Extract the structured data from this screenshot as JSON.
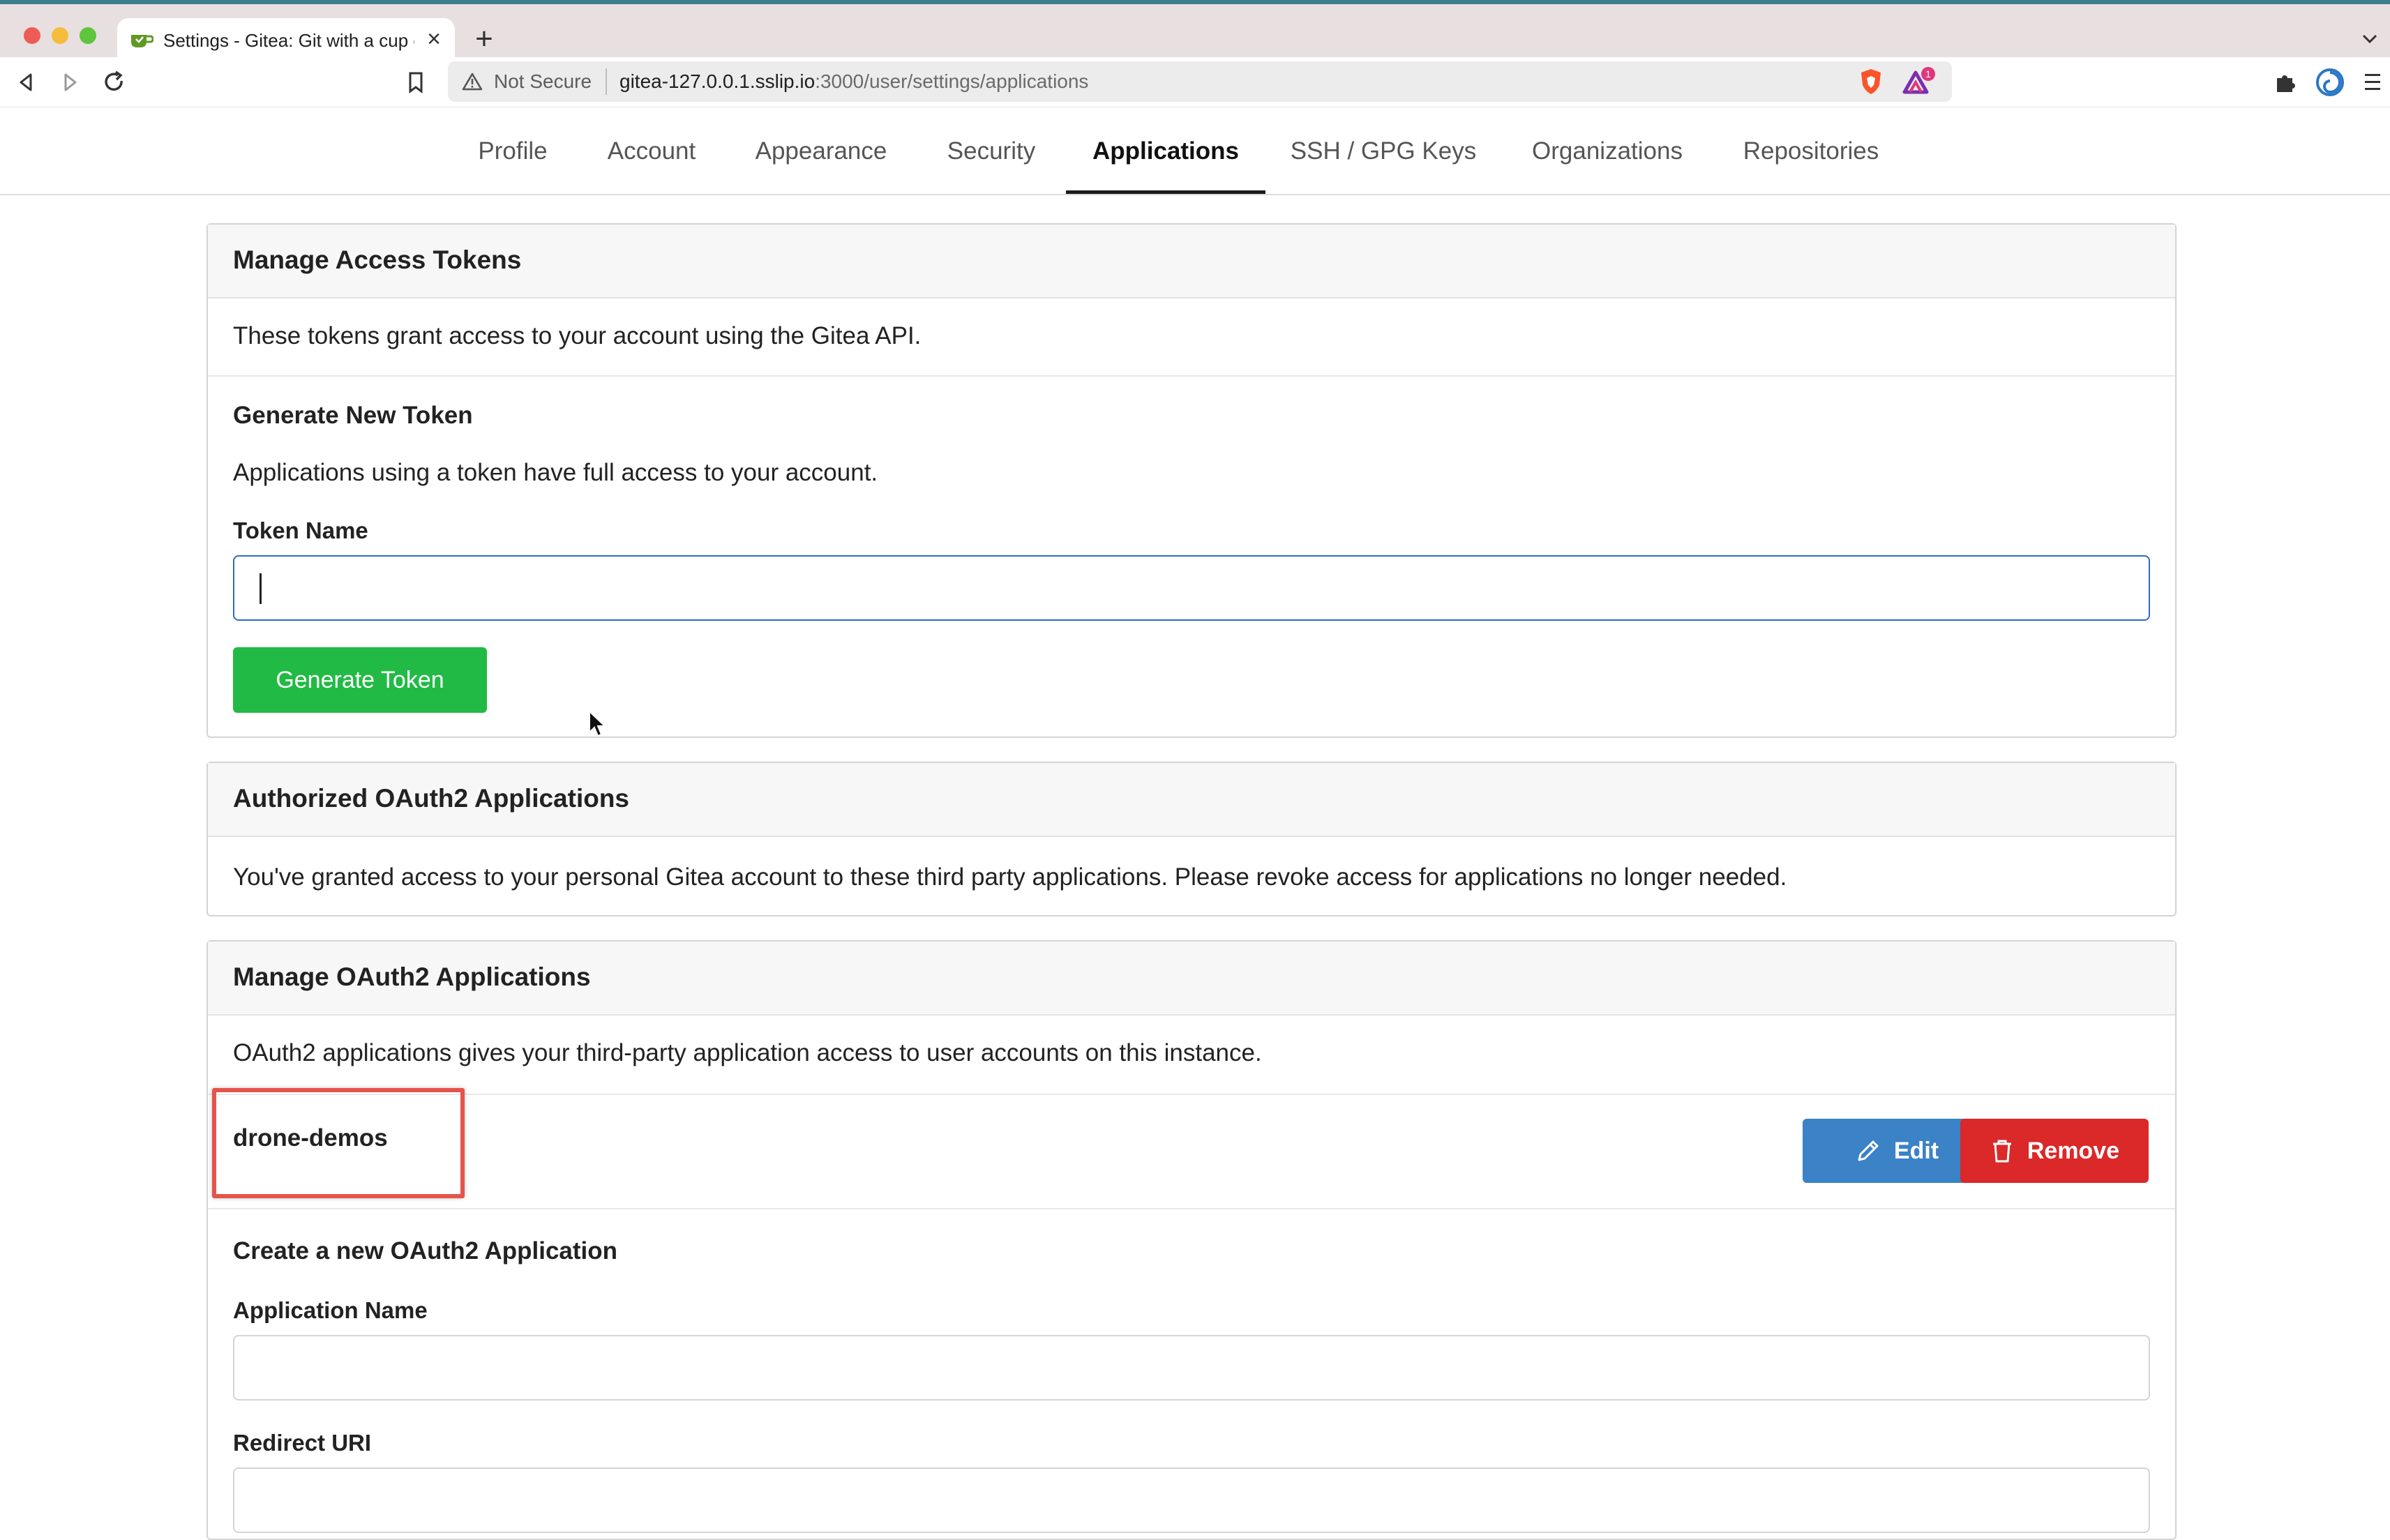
{
  "browser": {
    "tab_title": "Settings - Gitea: Git with a cup of tea",
    "omnibox_security": "Not Secure",
    "url_host": "gitea-127.0.0.1.sslip.io",
    "url_path": ":3000/user/settings/applications",
    "shields_badge": "1",
    "colors": {
      "close": "#ee5d55",
      "minimize": "#f6bd3b",
      "maximize": "#5fc53e"
    }
  },
  "settings_menu": {
    "items": [
      {
        "label": "Profile"
      },
      {
        "label": "Account"
      },
      {
        "label": "Appearance"
      },
      {
        "label": "Security"
      },
      {
        "label": "Applications",
        "active": true
      },
      {
        "label": "SSH / GPG Keys"
      },
      {
        "label": "Organizations"
      },
      {
        "label": "Repositories"
      }
    ]
  },
  "access_tokens": {
    "header": "Manage Access Tokens",
    "description": "These tokens grant access to your account using the Gitea API.",
    "generate_title": "Generate New Token",
    "generate_desc": "Applications using a token have full access to your account.",
    "token_name_label": "Token Name",
    "token_name_value": "",
    "generate_button": "Generate Token"
  },
  "authorized_oauth": {
    "header": "Authorized OAuth2 Applications",
    "description": "You've granted access to your personal Gitea account to these third party applications. Please revoke access for applications no longer needed."
  },
  "manage_oauth": {
    "header": "Manage OAuth2 Applications",
    "description": "OAuth2 applications gives your third-party application access to user accounts on this instance.",
    "apps": [
      {
        "name": "drone-demos",
        "edit_label": "Edit",
        "remove_label": "Remove"
      }
    ],
    "create_title": "Create a new OAuth2 Application",
    "app_name_label": "Application Name",
    "app_name_value": "",
    "redirect_label": "Redirect URI",
    "redirect_value": ""
  },
  "colors": {
    "green": "#21ba45",
    "blue": "#3b82c7",
    "red": "#db2828",
    "highlight": "#e5534b"
  }
}
